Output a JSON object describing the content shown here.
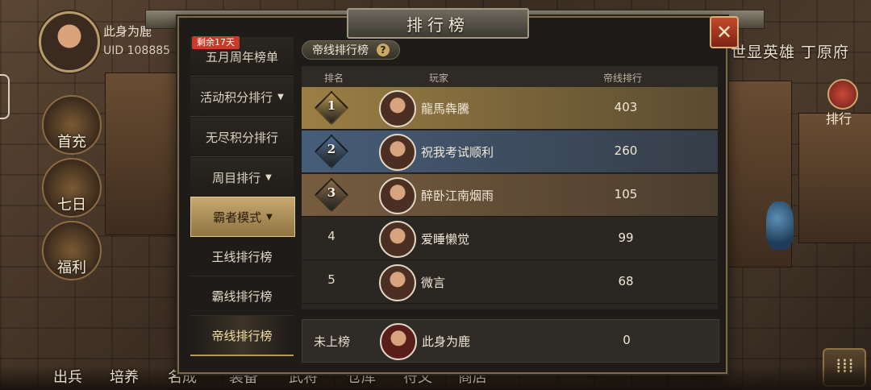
{
  "player": {
    "name": "此身为鹿",
    "uid": "UID  108885"
  },
  "left_menu": [
    {
      "label": "首充"
    },
    {
      "label": "七日"
    },
    {
      "label": "福利"
    }
  ],
  "right_side": {
    "title": "世显英雄 丁原府",
    "rank_button": "排行",
    "menu_icon": "menu-icon"
  },
  "bottom_nav": [
    "出兵",
    "培养",
    "名成",
    "装备",
    "武将",
    "仓库",
    "符文",
    "商店"
  ],
  "panel": {
    "title": "排行榜",
    "close": "✕",
    "badge": "剩余17天",
    "categories": [
      {
        "label": "五月周年榜单",
        "arrow": ""
      },
      {
        "label": "活动积分排行",
        "arrow": "▼"
      },
      {
        "label": "无尽积分排行",
        "arrow": ""
      },
      {
        "label": "周目排行",
        "arrow": "▼"
      },
      {
        "label": "霸者模式",
        "arrow": "▼"
      },
      {
        "label": "王线排行榜",
        "arrow": ""
      },
      {
        "label": "霸线排行榜",
        "arrow": ""
      },
      {
        "label": "帝线排行榜",
        "arrow": ""
      }
    ],
    "tab": {
      "label": "帝线排行榜",
      "help": "?"
    },
    "columns": {
      "rank": "排名",
      "player": "玩家",
      "score": "帝线排行"
    },
    "rows": [
      {
        "rank": "1",
        "player": "龍馬犇騰",
        "score": "403",
        "color": "#b8954d"
      },
      {
        "rank": "2",
        "player": "祝我考试顺利",
        "score": "260",
        "color": "#4d6b8f"
      },
      {
        "rank": "3",
        "player": "醉卧江南烟雨",
        "score": "105",
        "color": "#8a6a46"
      },
      {
        "rank": "4",
        "player": "爱睡懒觉",
        "score": "99",
        "color": ""
      },
      {
        "rank": "5",
        "player": "微言",
        "score": "68",
        "color": ""
      }
    ],
    "mine": {
      "label": "未上榜",
      "player": "此身为鹿",
      "score": "0"
    }
  }
}
